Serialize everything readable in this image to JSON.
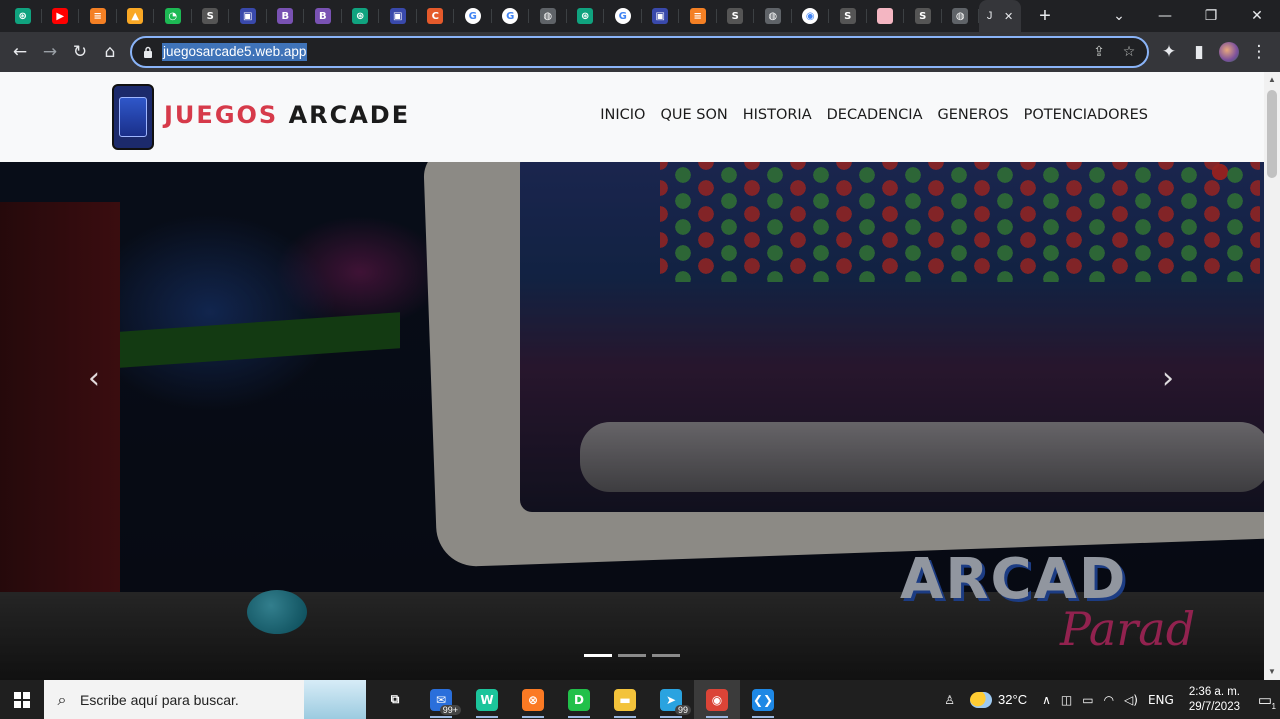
{
  "browser": {
    "tabs": [
      {
        "icon": "chatgpt-icon",
        "color": "#10a37f",
        "glyph": "⊛"
      },
      {
        "icon": "youtube-icon",
        "color": "#ff0000",
        "glyph": "▶"
      },
      {
        "icon": "stackoverflow-icon",
        "color": "#f48024",
        "glyph": "≡"
      },
      {
        "icon": "triangle-logo-icon",
        "color": "#f9a825",
        "glyph": "▲"
      },
      {
        "icon": "chart-icon",
        "color": "#1db954",
        "glyph": "◔"
      },
      {
        "icon": "soet-icon",
        "color": "#555555",
        "glyph": "S"
      },
      {
        "icon": "monitor-icon",
        "color": "#3949ab",
        "glyph": "▣"
      },
      {
        "icon": "bootstrap-icon",
        "color": "#7952b3",
        "glyph": "B"
      },
      {
        "icon": "bootstrap-icon",
        "color": "#7952b3",
        "glyph": "B"
      },
      {
        "icon": "chatgpt-icon",
        "color": "#10a37f",
        "glyph": "⊛"
      },
      {
        "icon": "monitor-icon",
        "color": "#3949ab",
        "glyph": "▣"
      },
      {
        "icon": "c-letter-icon",
        "color": "#e55a2b",
        "glyph": "C"
      },
      {
        "icon": "google-icon",
        "color": "#4285f4",
        "glyph": "G"
      },
      {
        "icon": "google-icon",
        "color": "#4285f4",
        "glyph": "G"
      },
      {
        "icon": "globe-icon",
        "color": "#5f6368",
        "glyph": "◍"
      },
      {
        "icon": "chatgpt-icon",
        "color": "#10a37f",
        "glyph": "⊛"
      },
      {
        "icon": "google-icon",
        "color": "#4285f4",
        "glyph": "G"
      },
      {
        "icon": "monitor-icon",
        "color": "#3949ab",
        "glyph": "▣"
      },
      {
        "icon": "stackoverflow-icon",
        "color": "#f48024",
        "glyph": "≡"
      },
      {
        "icon": "soet-icon",
        "color": "#555555",
        "glyph": "S"
      },
      {
        "icon": "globe-icon",
        "color": "#5f6368",
        "glyph": "◍"
      },
      {
        "icon": "chrome-icon",
        "color": "#ffffff",
        "glyph": "◉"
      },
      {
        "icon": "soet-icon",
        "color": "#555555",
        "glyph": "S"
      },
      {
        "icon": "pink-square-icon",
        "color": "#f4b6c2",
        "glyph": ""
      },
      {
        "icon": "soet-icon",
        "color": "#555555",
        "glyph": "S"
      },
      {
        "icon": "globe-icon",
        "color": "#5f6368",
        "glyph": "◍"
      }
    ],
    "active_tab": {
      "label": "J",
      "close": "✕"
    },
    "new_tab": "+",
    "window_controls": {
      "chevron": "⌄",
      "minimize": "—",
      "restore": "❐",
      "close": "✕"
    },
    "toolbar": {
      "back": "←",
      "forward": "→",
      "reload": "↻",
      "home": "⌂",
      "lock": "🔒",
      "share": "⇪",
      "star": "☆",
      "extensions": "✦",
      "sidebar": "▮",
      "menu": "⋮"
    },
    "url": "juegosarcade5.web.app"
  },
  "site": {
    "brand_part1": "JUEGOS",
    "brand_part2": "ARCADE",
    "brand_color": "#d63a4a",
    "menu": [
      "INICIO",
      "QUE SON",
      "HISTORIA",
      "DECADENCIA",
      "GENEROS",
      "POTENCIADORES"
    ],
    "hero": {
      "art_text_1": "ARCAD",
      "art_text_2": "Parad",
      "prev": "‹",
      "next": "›",
      "slides": 3,
      "active_slide": 1
    }
  },
  "taskbar": {
    "search_placeholder": "Escribe aquí para buscar.",
    "apps": [
      {
        "icon": "task-view-icon",
        "glyph": "⧉",
        "color": "transparent"
      },
      {
        "icon": "mail-icon",
        "glyph": "✉",
        "color": "#2a6fdb",
        "badge": "99+"
      },
      {
        "icon": "webstorm-icon",
        "glyph": "W",
        "color": "#1cc49b"
      },
      {
        "icon": "xampp-icon",
        "glyph": "⊗",
        "color": "#fb7a24"
      },
      {
        "icon": "dbeaver-icon",
        "glyph": "D",
        "color": "#21c04a"
      },
      {
        "icon": "file-explorer-icon",
        "glyph": "▬",
        "color": "#f3c33b"
      },
      {
        "icon": "telegram-icon",
        "glyph": "➤",
        "color": "#2aa3e0",
        "badge": "99"
      },
      {
        "icon": "chrome-icon",
        "glyph": "◉",
        "color": "#db4437"
      },
      {
        "icon": "vscode-icon",
        "glyph": "❮❯",
        "color": "#1e88e5"
      }
    ],
    "temperature": "32°C",
    "language": "ENG",
    "time": "2:36 a. m.",
    "date": "29/7/2023",
    "notifications": "1"
  }
}
